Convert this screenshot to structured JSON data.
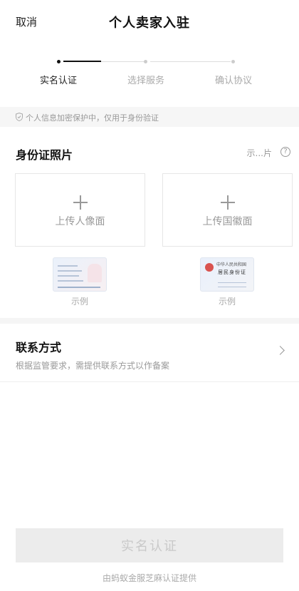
{
  "header": {
    "cancel_label": "取消",
    "title": "个人卖家入驻"
  },
  "steps": [
    {
      "label": "实名认证",
      "active": true
    },
    {
      "label": "选择服务",
      "active": false
    },
    {
      "label": "确认协议",
      "active": false
    }
  ],
  "privacy": {
    "text": "个人信息加密保护中，仅用于身份验证"
  },
  "id_section": {
    "title": "身份证照片",
    "sample_link": "示...片",
    "help": "?",
    "front_label": "上传人像面",
    "back_label": "上传国徽面",
    "sample_caption_front": "示例",
    "sample_caption_back": "示例",
    "card_back_title": "中华人民共和国",
    "card_back_sub": "居民身份证"
  },
  "contact": {
    "title": "联系方式",
    "desc": "根据监管要求，需提供联系方式以作备案"
  },
  "submit_label": "实名认证",
  "footer": "由蚂蚁金服芝麻认证提供",
  "colors": {
    "active": "#111111",
    "muted": "#aaaaaa",
    "disabled_bg": "#ececec"
  }
}
